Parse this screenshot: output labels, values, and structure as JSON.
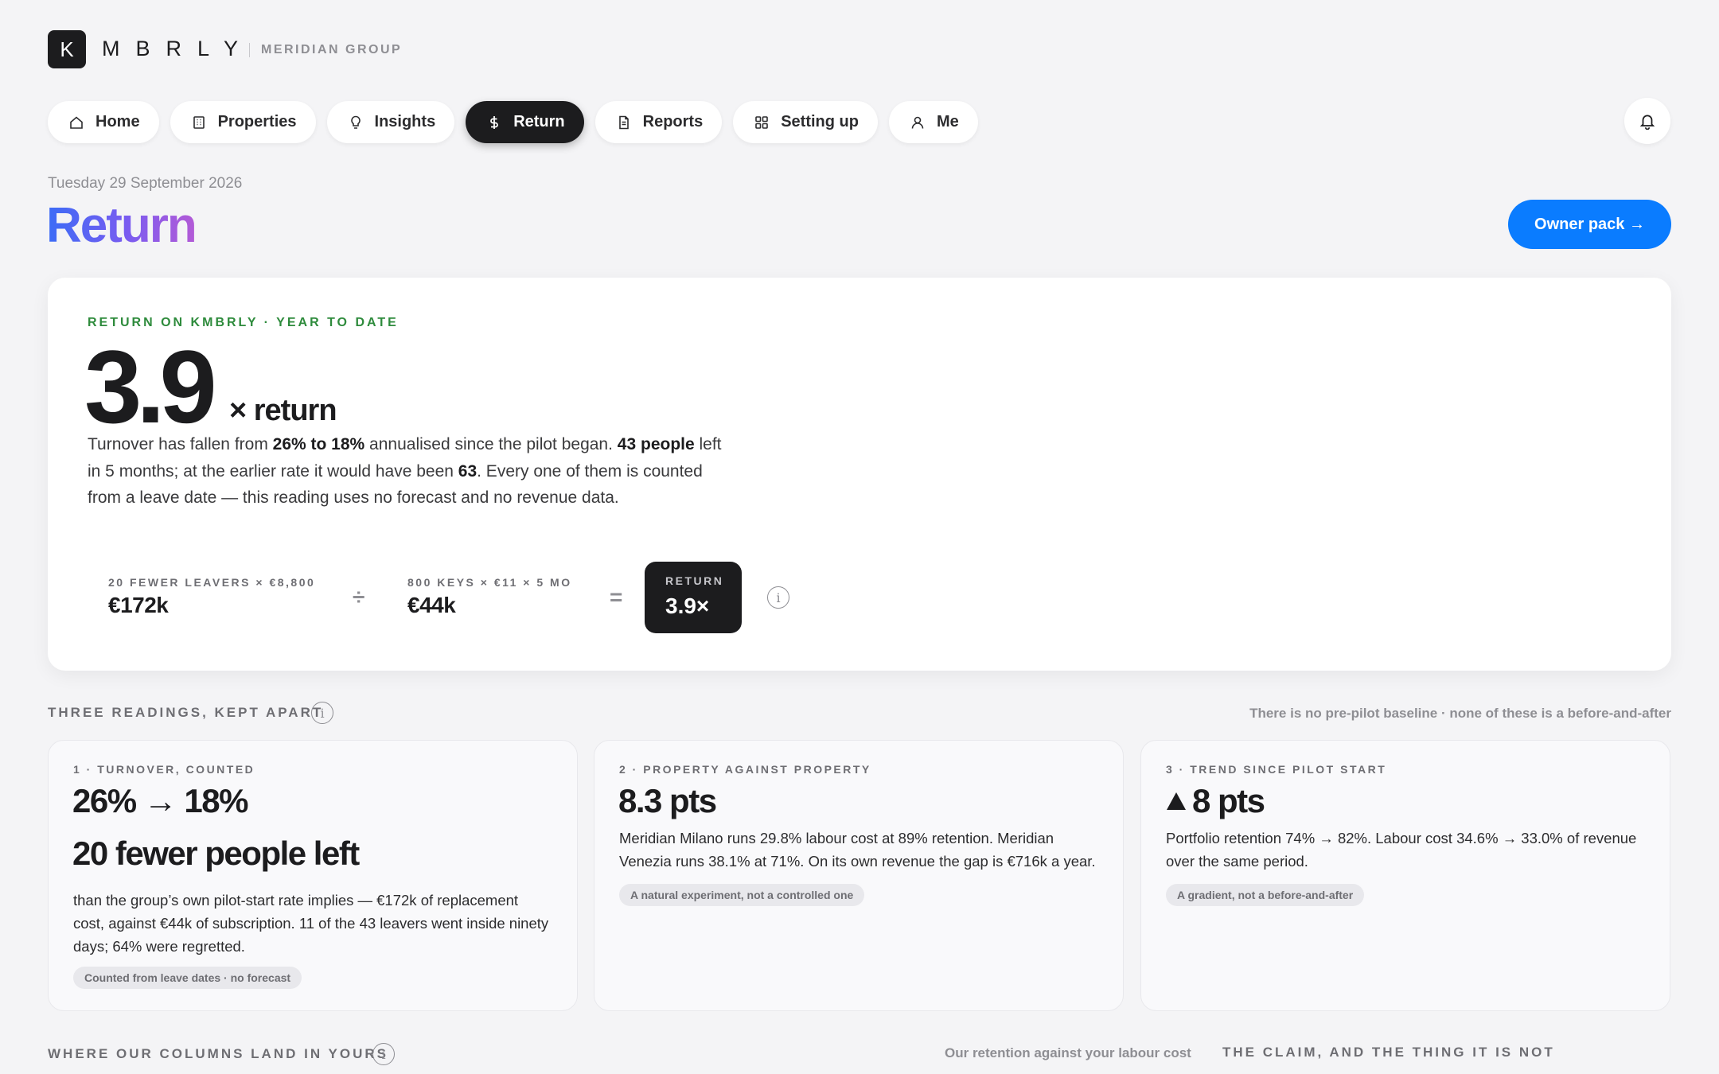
{
  "brand": {
    "logo_letter": "K",
    "wordmark": "MBRLY",
    "group": "MERIDIAN GROUP"
  },
  "nav": {
    "items": [
      {
        "label": "Home",
        "icon": "home-icon"
      },
      {
        "label": "Properties",
        "icon": "building-icon"
      },
      {
        "label": "Insights",
        "icon": "lightbulb-icon"
      },
      {
        "label": "Return",
        "icon": "dollar-icon",
        "active": true
      },
      {
        "label": "Reports",
        "icon": "document-icon"
      },
      {
        "label": "Setting up",
        "icon": "grid-icon"
      },
      {
        "label": "Me",
        "icon": "user-icon"
      }
    ]
  },
  "header": {
    "date": "Tuesday 29 September 2026",
    "title": "Return",
    "owner_pack_label": "Owner pack →"
  },
  "hero": {
    "eyebrow": "RETURN ON KMBRLY · YEAR TO DATE",
    "value": "3.9",
    "suffix": "× return",
    "para": {
      "t1": "Turnover has fallen from ",
      "b1": "26% to 18%",
      "t2": " annualised since the pilot began. ",
      "b2": "43 people",
      "t3": " left in 5 months; at the earlier rate it would have been ",
      "b3": "63",
      "t4": ". Every one of them is counted from a leave date — this reading uses no forecast and no revenue data."
    },
    "calc": {
      "left_label": "20 FEWER LEAVERS × €8,800",
      "left_value": "€172k",
      "divide": "÷",
      "mid_label": "800 KEYS × €11 × 5 MO",
      "mid_value": "€44k",
      "equals": "=",
      "result_label": "RETURN",
      "result_value": "3.9×"
    }
  },
  "readings": {
    "label": "THREE READINGS, KEPT APART",
    "note": "There is no pre-pilot baseline · none of these is a before-and-after",
    "cards": [
      {
        "eyebrow": "1 · TURNOVER, COUNTED",
        "headline": "26% → 18%",
        "subheadline": "20 fewer people left",
        "body": "than the group’s own pilot-start rate implies — €172k of replacement cost, against €44k of subscription. 11 of the 43 leavers went inside ninety days; 64% were regretted.",
        "tag": "Counted from leave dates · no forecast"
      },
      {
        "eyebrow": "2 · PROPERTY AGAINST PROPERTY",
        "headline": "8.3 pts",
        "body": "Meridian Milano runs 29.8% labour cost at 89% retention. Meridian Venezia runs 38.1% at 71%. On its own revenue the gap is €716k a year.",
        "tag": "A natural experiment, not a controlled one"
      },
      {
        "eyebrow": "3 · TREND SINCE PILOT START",
        "headline_icon": "triangle-up-icon",
        "headline": "8 pts",
        "body": "Portfolio retention 74% → 82%. Labour cost 34.6% → 33.0% of revenue over the same period.",
        "tag": "A gradient, not a before-and-after"
      }
    ]
  },
  "columns": {
    "label": "WHERE OUR COLUMNS LAND IN YOURS",
    "note": "Our retention against your labour cost",
    "claim_label": "THE CLAIM, AND THE THING IT IS NOT"
  }
}
